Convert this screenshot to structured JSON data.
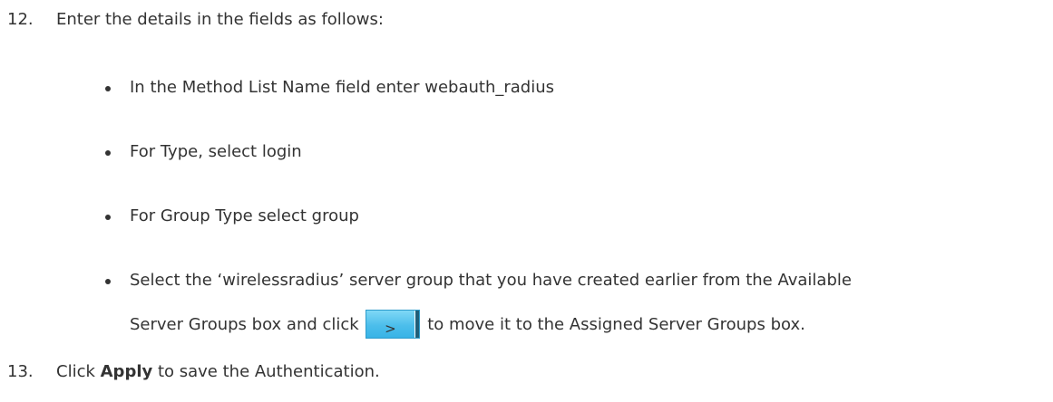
{
  "steps": [
    {
      "number": "12.",
      "text": "Enter the details in the fields as follows:",
      "bullets": [
        "In the Method List Name field enter webauth_radius",
        "For Type, select login",
        "For Group Type select group",
        {
          "line1": "Select the ‘wirelessradius’ server group that you have created earlier from the Available",
          "line2_before": "Server Groups box and click",
          "button_glyph": ">",
          "button_icon": "move-right-button-icon",
          "line2_after": "to move it to the Assigned Server Groups box."
        }
      ]
    },
    {
      "number": "13.",
      "text_before": "Click ",
      "bold": "Apply",
      "text_after": " to save the Authentication."
    }
  ],
  "colors": {
    "text": "#333333",
    "button_light": "#7fd8f6",
    "button_dark": "#38b3e6"
  }
}
